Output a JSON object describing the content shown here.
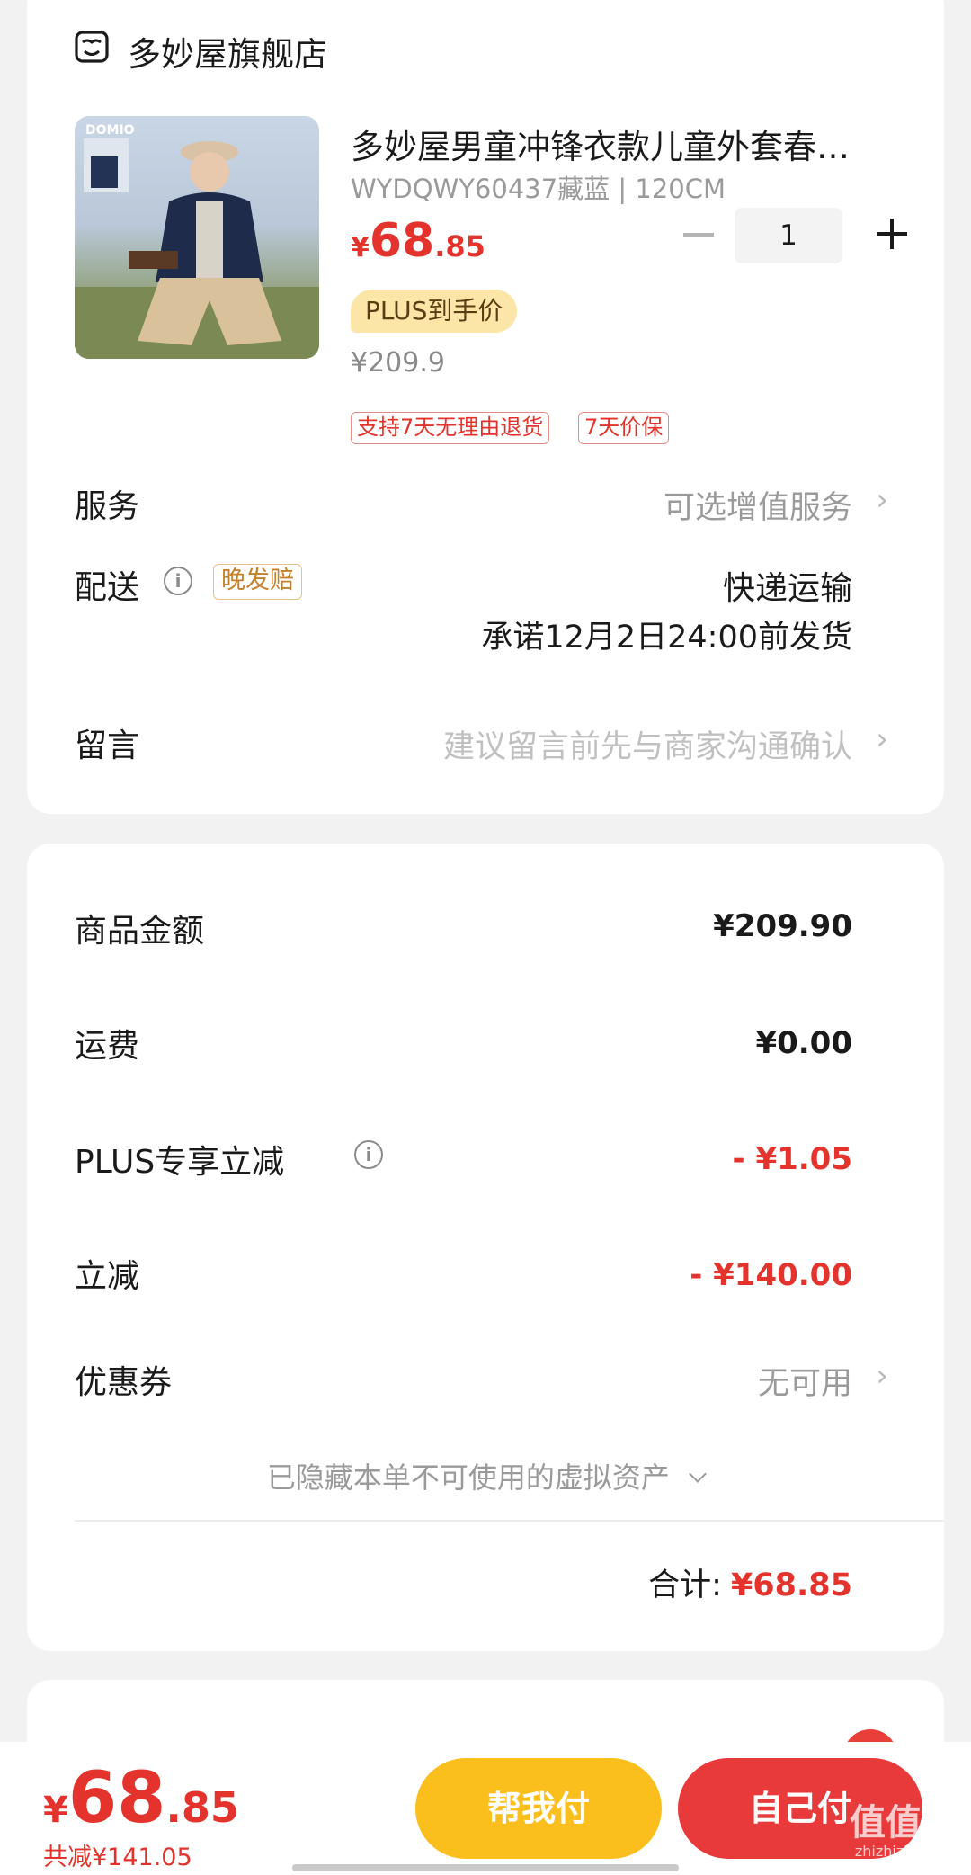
{
  "shop": {
    "name": "多妙屋旗舰店",
    "icon": "shop-icon"
  },
  "product": {
    "title": "多妙屋男童冲锋衣款儿童外套春…",
    "sku": "WYDQWY60437藏蓝 | 120CM",
    "price_symbol": "¥",
    "price_int": "68",
    "price_dec": ".85",
    "plus_badge": "PLUS到手价",
    "original_price": "¥209.9",
    "quantity": "1",
    "tags": [
      "支持7天无理由退货",
      "7天价保"
    ],
    "image_brand": "DOMIO"
  },
  "service": {
    "label": "服务",
    "value": "可选增值服务"
  },
  "delivery": {
    "label": "配送",
    "badge": "晚发赔",
    "method": "快递运输",
    "promise": "承诺12月2日24:00前发货"
  },
  "message": {
    "label": "留言",
    "placeholder": "建议留言前先与商家沟通确认"
  },
  "summary": {
    "goods_label": "商品金额",
    "goods_value": "¥209.90",
    "shipping_label": "运费",
    "shipping_value": "¥0.00",
    "plus_label": "PLUS专享立减",
    "plus_value": "- ¥1.05",
    "discount_label": "立减",
    "discount_value": "- ¥140.00",
    "coupon_label": "优惠券",
    "coupon_value": "无可用",
    "hidden_assets": "已隐藏本单不可使用的虚拟资产",
    "total_label": "合计:",
    "total_value": "¥68.85"
  },
  "bottom": {
    "price_symbol": "¥",
    "price_int": "68",
    "price_dec": ".85",
    "saved": "共减¥141.05",
    "help_pay": "帮我付",
    "self_pay": "自己付",
    "watermark_text": "值值值",
    "watermark_url": "zhizhizhi.com"
  },
  "colors": {
    "accent_red": "#e4332c",
    "plus_badge_bg": "#fbe6a8",
    "help_btn": "#fbbf1d",
    "self_btn": "#e83a3a"
  }
}
